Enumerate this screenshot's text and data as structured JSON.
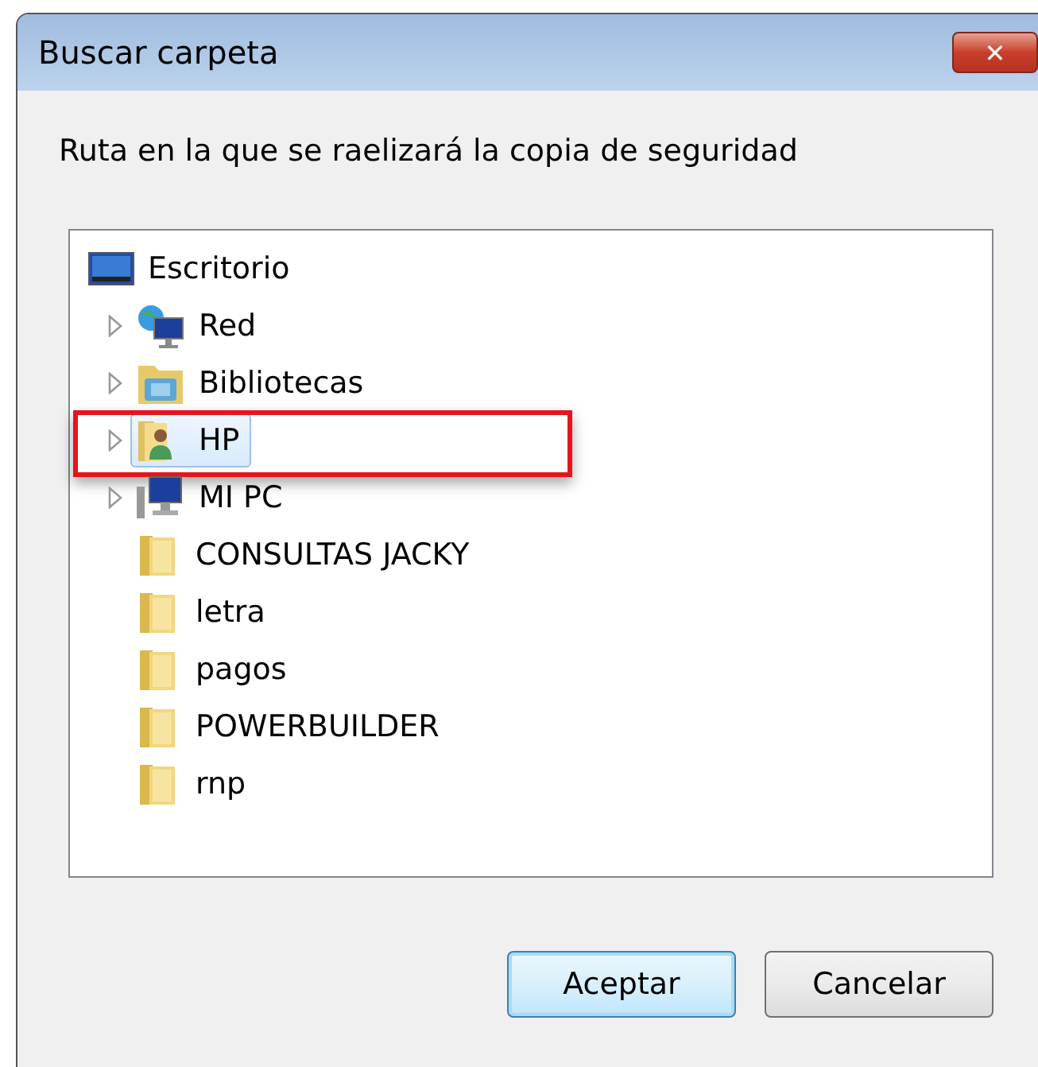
{
  "window": {
    "title": "Buscar carpeta",
    "close_label": "✕"
  },
  "description": "Ruta en la que se raelizará la copia de seguridad",
  "tree": {
    "items": [
      {
        "label": "Escritorio",
        "kind": "desktop",
        "selected": false,
        "highlighted": false,
        "children": [
          {
            "label": "Red",
            "kind": "network",
            "expandable": true,
            "selected": false,
            "highlighted": false
          },
          {
            "label": "Bibliotecas",
            "kind": "library",
            "expandable": true,
            "selected": false,
            "highlighted": false
          },
          {
            "label": "HP",
            "kind": "user",
            "expandable": true,
            "selected": true,
            "highlighted": true
          },
          {
            "label": "MI PC",
            "kind": "computer",
            "expandable": true,
            "selected": false,
            "highlighted": false
          },
          {
            "label": "CONSULTAS JACKY",
            "kind": "folder",
            "expandable": false,
            "selected": false,
            "highlighted": false
          },
          {
            "label": "letra",
            "kind": "folder",
            "expandable": false,
            "selected": false,
            "highlighted": false
          },
          {
            "label": "pagos",
            "kind": "folder",
            "expandable": false,
            "selected": false,
            "highlighted": false
          },
          {
            "label": "POWERBUILDER",
            "kind": "folder",
            "expandable": false,
            "selected": false,
            "highlighted": false
          },
          {
            "label": "rnp",
            "kind": "folder",
            "expandable": false,
            "selected": false,
            "highlighted": false
          }
        ]
      }
    ]
  },
  "buttons": [
    {
      "label": "Aceptar",
      "default": true
    },
    {
      "label": "Cancelar",
      "default": false
    }
  ]
}
